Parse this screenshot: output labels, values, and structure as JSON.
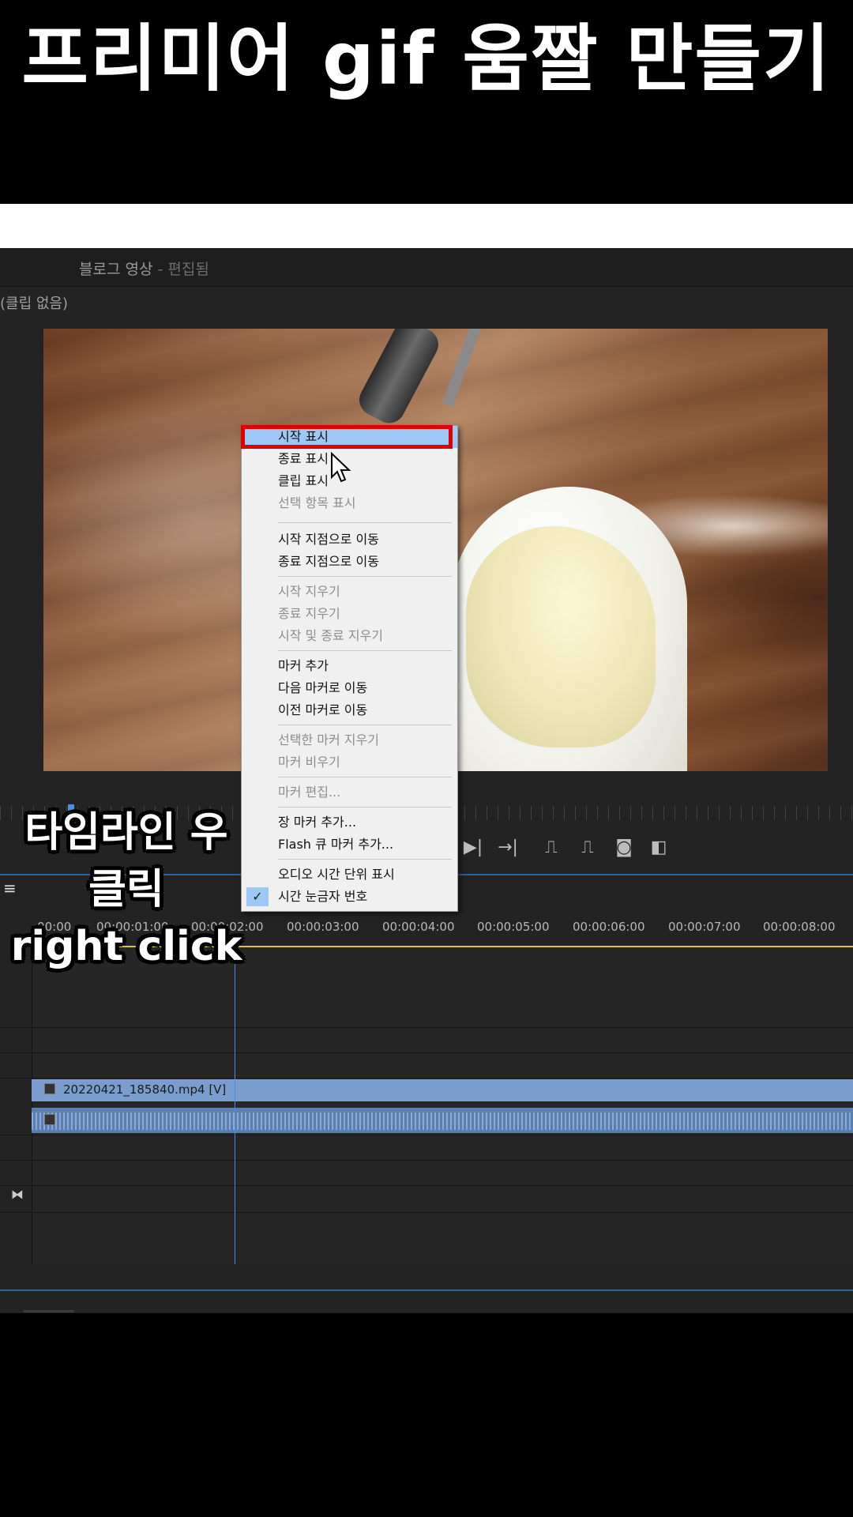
{
  "banner": {
    "title": "프리미어 gif 움짤 만들기"
  },
  "monitor": {
    "sequence_name": "블로그 영상",
    "sequence_suffix": " - 편집됨",
    "source_label": "(클립 없음)"
  },
  "caption": {
    "line1": "타임라인 우클릭",
    "line2": "right click"
  },
  "transport_icons": [
    "step-forward-icon",
    "go-to-out-icon",
    "lift-icon",
    "extract-icon",
    "export-frame-icon",
    "compare-icon"
  ],
  "timeline": {
    "timecodes": [
      ":00:00",
      "00:00:01:00",
      "00:00:02:00",
      "00:00:03:00",
      "00:00:04:00",
      "00:00:05:00",
      "00:00:06:00",
      "00:00:07:00",
      "00:00:08:00"
    ],
    "video_clip": "20220421_185840.mp4 [V]"
  },
  "context_menu": {
    "items": [
      {
        "label": "시작 표시",
        "state": "highlighted"
      },
      {
        "label": "종료 표시",
        "state": "enabled"
      },
      {
        "label": "클립 표시",
        "state": "enabled"
      },
      {
        "label": "선택 항목 표시",
        "state": "disabled"
      },
      {
        "label": "시작 지점으로 이동",
        "state": "enabled"
      },
      {
        "label": "종료 지점으로 이동",
        "state": "enabled"
      },
      {
        "label": "시작 지우기",
        "state": "disabled"
      },
      {
        "label": "종료 지우기",
        "state": "disabled"
      },
      {
        "label": "시작 및 종료 지우기",
        "state": "disabled"
      },
      {
        "label": "마커 추가",
        "state": "enabled"
      },
      {
        "label": "다음 마커로 이동",
        "state": "enabled"
      },
      {
        "label": "이전 마커로 이동",
        "state": "enabled"
      },
      {
        "label": "선택한 마커 지우기",
        "state": "disabled"
      },
      {
        "label": "마커 비우기",
        "state": "disabled"
      },
      {
        "label": "마커 편집...",
        "state": "disabled"
      },
      {
        "label": "장 마커 추가...",
        "state": "enabled"
      },
      {
        "label": "Flash 큐 마커 추가...",
        "state": "enabled"
      },
      {
        "label": "오디오 시간 단위 표시",
        "state": "enabled"
      },
      {
        "label": "시간 눈금자 번호",
        "state": "checked"
      }
    ]
  },
  "colors": {
    "highlight": "#9dc8f5",
    "callout": "#e00000",
    "clip_video": "#7a9dce",
    "playhead": "#4a90e2"
  }
}
